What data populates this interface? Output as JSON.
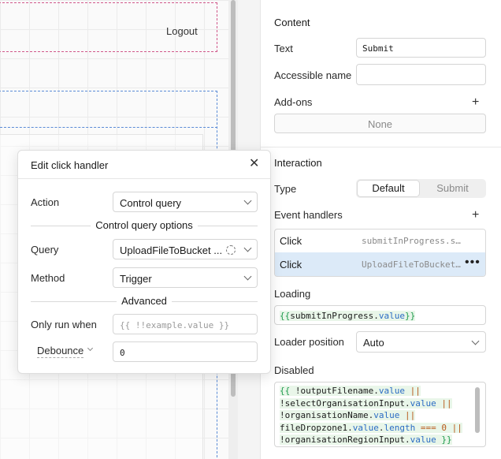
{
  "canvas": {
    "logout_label": "Logout"
  },
  "panel": {
    "content": {
      "title": "Content",
      "text_label": "Text",
      "text_value": "Submit",
      "accessible_name_label": "Accessible name",
      "accessible_name_value": "",
      "addons_label": "Add-ons",
      "addons_none": "None"
    },
    "interaction": {
      "title": "Interaction",
      "type_label": "Type",
      "type_options": [
        "Default",
        "Submit"
      ],
      "type_selected": "Default",
      "event_handlers_label": "Event handlers",
      "handlers": [
        {
          "event": "Click",
          "value": "submitInProgress.setValue"
        },
        {
          "event": "Click",
          "value": "UploadFileToBucket.trigger",
          "selected": true
        }
      ],
      "loading_label": "Loading",
      "loading_value": {
        "open": "{{",
        "obj": "submitInProgress",
        "prop": "value",
        "close": "}}"
      },
      "loader_position_label": "Loader position",
      "loader_position_value": "Auto",
      "disabled_label": "Disabled",
      "disabled_lines": [
        {
          "pre": "{{ !",
          "obj": "outputFilename",
          "prop": "value",
          "op": " ||"
        },
        {
          "pre": "!",
          "obj": "selectOrganisationInput",
          "prop": "value",
          "op": " ||"
        },
        {
          "pre": "!",
          "obj": "organisationName",
          "prop": "value",
          "op": " ||"
        },
        {
          "pre": "",
          "obj": "fileDropzone1",
          "prop": "value",
          "prop2": "length",
          "cmp": " === ",
          "num": "0",
          "op": " ||"
        },
        {
          "pre": "!",
          "obj": "organisationRegionInput",
          "prop": "value",
          "close": " }}"
        }
      ]
    }
  },
  "modal": {
    "title": "Edit click handler",
    "action_label": "Action",
    "action_value": "Control query",
    "section_label": "Control query options",
    "query_label": "Query",
    "query_value": "UploadFileToBucket ...",
    "method_label": "Method",
    "method_value": "Trigger",
    "advanced_label": "Advanced",
    "only_run_when_label": "Only run when",
    "only_run_when_placeholder": "{{ !!example.value }}",
    "debounce_label": "Debounce",
    "debounce_value": "0"
  },
  "icons": {
    "close": "close-icon",
    "plus": "plus-icon",
    "more": "more-horizontal-icon",
    "chevron": "chevron-down-icon",
    "query_status": "loading-circle-icon"
  }
}
